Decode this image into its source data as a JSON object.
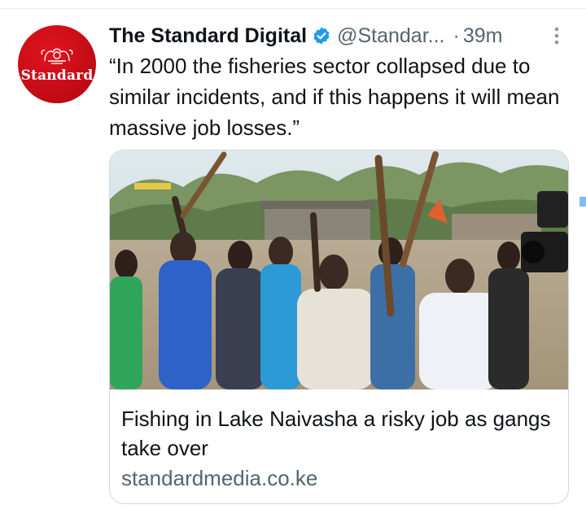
{
  "tweet": {
    "display_name": "The Standard Digital",
    "verified": true,
    "handle": "@Standar...",
    "separator": "·",
    "time": "39m",
    "text": "“In 2000 the fisheries sector collapsed due to similar incidents, and if this happens it will mean massive job losses.”"
  },
  "avatar": {
    "wordmark": "Standard",
    "background_color": "#d0101a"
  },
  "link_card": {
    "image_description_icon": "photo",
    "title": "Fishing in Lake Naivasha a risky job as gangs take over",
    "domain": "standardmedia.co.ke"
  },
  "colors": {
    "primary_text": "#0f1419",
    "secondary_text": "#536471",
    "verified_badge": "#1d9bf0",
    "border": "#cfd9de"
  },
  "icons": {
    "verified": "verified-badge-icon",
    "more": "more-vertical-icon"
  }
}
